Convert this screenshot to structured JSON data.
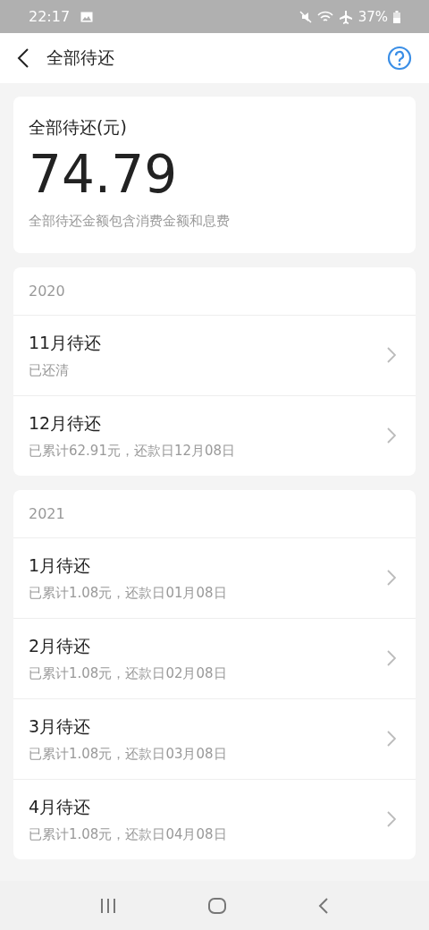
{
  "status_bar": {
    "time": "22:17",
    "battery": "37%"
  },
  "header": {
    "title": "全部待还"
  },
  "summary": {
    "label": "全部待还(元)",
    "amount": "74.79",
    "note": "全部待还金额包含消费金额和息费"
  },
  "years": [
    {
      "year": "2020",
      "months": [
        {
          "title": "11月待还",
          "detail": "已还清"
        },
        {
          "title": "12月待还",
          "detail": "已累计62.91元，还款日12月08日"
        }
      ]
    },
    {
      "year": "2021",
      "months": [
        {
          "title": "1月待还",
          "detail": "已累计1.08元，还款日01月08日"
        },
        {
          "title": "2月待还",
          "detail": "已累计1.08元，还款日02月08日"
        },
        {
          "title": "3月待还",
          "detail": "已累计1.08元，还款日03月08日"
        },
        {
          "title": "4月待还",
          "detail": "已累计1.08元，还款日04月08日"
        }
      ]
    }
  ]
}
